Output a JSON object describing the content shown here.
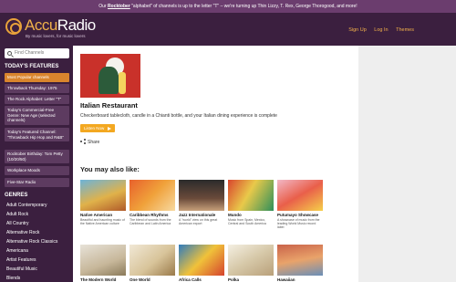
{
  "banner": {
    "prefix": "Our ",
    "link": "Rocktober",
    "suffix": " \"alphabet\" of channels is up to the letter \"T\" – we're turning up Thin Lizzy, T. Rex, George Thorogood, and more!"
  },
  "header": {
    "logo_accent": "Accu",
    "logo_main": "Radio",
    "tagline": "By music lovers, for music lovers",
    "nav": [
      "Sign Up",
      "Log In",
      "Themes"
    ]
  },
  "sidebar": {
    "search_placeholder": "Find Channels",
    "features_title": "TODAY'S FEATURES",
    "features": [
      "Most Popular channels",
      "Throwback Thursday: 1975",
      "The Rock Alphabet: Letter \"T\"",
      "Today's Commercial-Free Genre: New Age (selected channels)",
      "Today's Featured Channel: \"Throwback Hip Hop and R&B\"",
      "Rocktober Birthday: Tom Petty (10/20/50)",
      "Workplace Moods",
      "Five-Star Radio"
    ],
    "genres_title": "GENRES",
    "genres": [
      "Adult Contemporary",
      "Adult Rock",
      "All Country",
      "Alternative Rock",
      "Alternative Rock Classics",
      "Americana",
      "Artist Features",
      "Beautiful Music",
      "Blends"
    ]
  },
  "station": {
    "title": "Italian Restaurant",
    "description": "Checkerboard tablecloth, candle in a Chianti bottle, and your Italian dining experience is complete",
    "listen_label": "Listen Now",
    "share_label": "Share"
  },
  "recommendations": {
    "title": "You may also like:",
    "row1": [
      {
        "title": "Native American",
        "desc": "Beautiful and haunting music of the Native American culture"
      },
      {
        "title": "Caribbean Rhythms",
        "desc": "The blend of sounds from the Caribbean and Latin America"
      },
      {
        "title": "Jazz Internationale",
        "desc": "A \"world\" view on this great American export"
      },
      {
        "title": "Mundo",
        "desc": "Music from Spain, Mexico, Central and South America"
      },
      {
        "title": "Putumayo Showcase",
        "desc": "A showcase of music from the leading World Music record label"
      }
    ],
    "row2": [
      {
        "title": "The Modern World",
        "desc": ""
      },
      {
        "title": "One World",
        "desc": ""
      },
      {
        "title": "Africa Calls",
        "desc": ""
      },
      {
        "title": "Polka",
        "desc": ""
      },
      {
        "title": "Hawaiian",
        "desc": ""
      }
    ]
  },
  "colors": {
    "brand_dark": "#3b1f3f",
    "brand_orange": "#f3a821",
    "active_item": "#d9852d",
    "banner": "#6b3d6e"
  }
}
